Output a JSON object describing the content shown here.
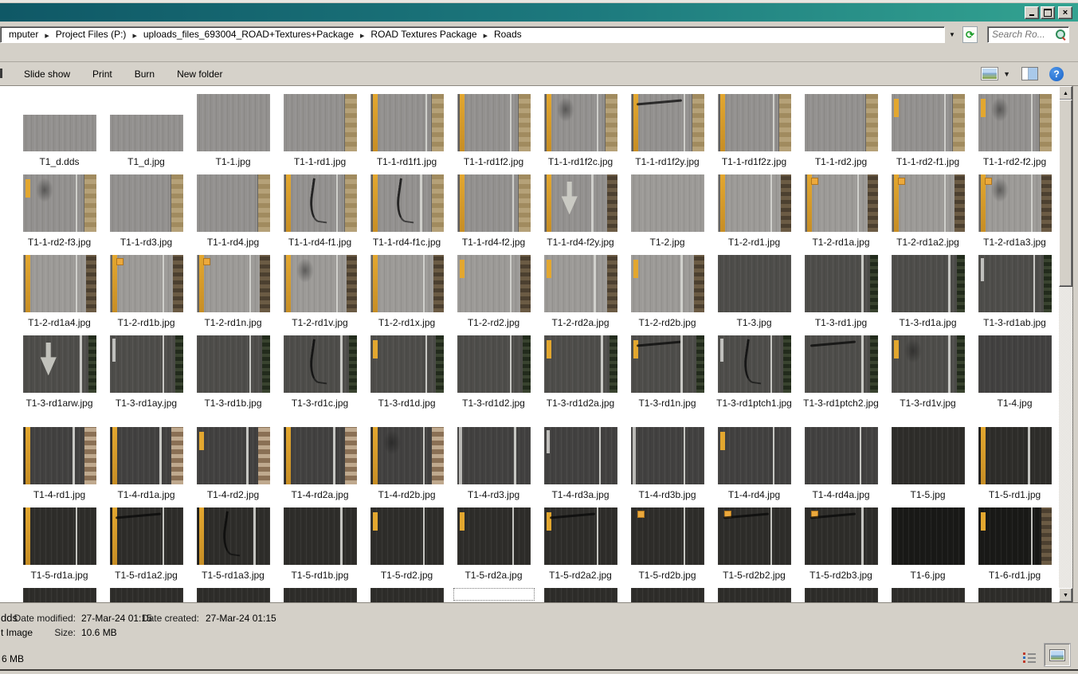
{
  "window": {
    "buttons": {
      "minimize": "minimize",
      "maximize": "maximize",
      "close": "close"
    },
    "titlebar_gradient": [
      "#0f5866",
      "#33a391"
    ]
  },
  "address_bar": {
    "breadcrumbs": [
      "mputer",
      "Project Files (P:)",
      "uploads_files_693004_ROAD+Textures+Package",
      "ROAD Textures Package",
      "Roads"
    ],
    "search_placeholder": "Search Ro..."
  },
  "toolbar": {
    "items": [
      "Slide show",
      "Print",
      "Burn",
      "New folder"
    ]
  },
  "files": [
    {
      "name": "T1_d.dds",
      "base": "g",
      "wide": true,
      "layers": []
    },
    {
      "name": "T1_d.jpg",
      "base": "g",
      "wide": true,
      "layers": []
    },
    {
      "name": "T1-1.jpg",
      "base": "g",
      "layers": []
    },
    {
      "name": "T1-1-rd1.jpg",
      "base": "g",
      "layers": [
        "dirt"
      ]
    },
    {
      "name": "T1-1-rd1f1.jpg",
      "base": "g",
      "layers": [
        "yl",
        "wl75",
        "dirt"
      ]
    },
    {
      "name": "T1-1-rd1f2.jpg",
      "base": "g",
      "layers": [
        "yl",
        "wl72",
        "dirt"
      ]
    },
    {
      "name": "T1-1-rd1f2c.jpg",
      "base": "g",
      "layers": [
        "yl",
        "smudge",
        "wl72",
        "dirt"
      ]
    },
    {
      "name": "T1-1-rd1f2y.jpg",
      "base": "g",
      "layers": [
        "yl",
        "crackh",
        "wl72",
        "dirt"
      ]
    },
    {
      "name": "T1-1-rd1f2z.jpg",
      "base": "g",
      "layers": [
        "yl",
        "wl75",
        "dirt"
      ]
    },
    {
      "name": "T1-1-rd2.jpg",
      "base": "g",
      "layers": [
        "dirt"
      ]
    },
    {
      "name": "T1-1-rd2-f1.jpg",
      "base": "g",
      "layers": [
        "ydash",
        "wl72",
        "dirt"
      ]
    },
    {
      "name": "T1-1-rd2-f2.jpg",
      "base": "g",
      "layers": [
        "ydash",
        "smudge",
        "wl72",
        "dirt"
      ]
    },
    {
      "name": "T1-1-rd2-f3.jpg",
      "base": "g",
      "layers": [
        "ydash",
        "smudge",
        "wl72",
        "dirt"
      ]
    },
    {
      "name": "T1-1-rd3.jpg",
      "base": "g",
      "layers": [
        "dirt"
      ]
    },
    {
      "name": "T1-1-rd4.jpg",
      "base": "g",
      "layers": [
        "dirt"
      ]
    },
    {
      "name": "T1-1-rd4-f1.jpg",
      "base": "g",
      "layers": [
        "yl",
        "crack",
        "wl72",
        "dirt"
      ]
    },
    {
      "name": "T1-1-rd4-f1c.jpg",
      "base": "g",
      "layers": [
        "yl",
        "crack",
        "wl68",
        "dirt"
      ]
    },
    {
      "name": "T1-1-rd4-f2.jpg",
      "base": "g",
      "layers": [
        "yl",
        "wl75",
        "dirt"
      ]
    },
    {
      "name": "T1-1-rd4-f2y.jpg",
      "base": "g",
      "layers": [
        "yl",
        "arrow",
        "wl65",
        "dirtdark"
      ]
    },
    {
      "name": "T1-2.jpg",
      "base": "g2",
      "layers": []
    },
    {
      "name": "T1-2-rd1.jpg",
      "base": "g2",
      "layers": [
        "yl",
        "wl72",
        "dirtdark"
      ]
    },
    {
      "name": "T1-2-rd1a.jpg",
      "base": "g2",
      "layers": [
        "yl",
        "ydot",
        "wl72",
        "dirtdark"
      ]
    },
    {
      "name": "T1-2-rd1a2.jpg",
      "base": "g2",
      "layers": [
        "yl",
        "ydot",
        "wl72",
        "dirtdark"
      ]
    },
    {
      "name": "T1-2-rd1a3.jpg",
      "base": "g2",
      "layers": [
        "yl",
        "ydot",
        "smudge",
        "wl72",
        "dirtdark"
      ]
    },
    {
      "name": "T1-2-rd1a4.jpg",
      "base": "g2",
      "layers": [
        "yl",
        "wl72",
        "dirtdark"
      ]
    },
    {
      "name": "T1-2-rd1b.jpg",
      "base": "g2",
      "layers": [
        "yl",
        "ydot",
        "wl72",
        "dirtdark"
      ]
    },
    {
      "name": "T1-2-rd1n.jpg",
      "base": "g2",
      "layers": [
        "yl",
        "ydot",
        "wl72",
        "dirtdark"
      ]
    },
    {
      "name": "T1-2-rd1v.jpg",
      "base": "g2",
      "layers": [
        "yl",
        "smudge",
        "wl72",
        "dirtdark"
      ]
    },
    {
      "name": "T1-2-rd1x.jpg",
      "base": "g2",
      "layers": [
        "yl",
        "wl72",
        "dirtdark"
      ]
    },
    {
      "name": "T1-2-rd2.jpg",
      "base": "g2",
      "layers": [
        "ydash",
        "wl72",
        "dirtdark"
      ]
    },
    {
      "name": "T1-2-rd2a.jpg",
      "base": "g2",
      "layers": [
        "ydash",
        "wl68",
        "dirtdark"
      ]
    },
    {
      "name": "T1-2-rd2b.jpg",
      "base": "g2",
      "layers": [
        "ydash",
        "wl68",
        "dirtdark"
      ]
    },
    {
      "name": "T1-3.jpg",
      "base": "d",
      "layers": []
    },
    {
      "name": "T1-3-rd1.jpg",
      "base": "d",
      "layers": [
        "wl78",
        "grass"
      ]
    },
    {
      "name": "T1-3-rd1a.jpg",
      "base": "d",
      "layers": [
        "wl78",
        "grass"
      ]
    },
    {
      "name": "T1-3-rd1ab.jpg",
      "base": "d",
      "layers": [
        "wdash",
        "wl75",
        "grass"
      ]
    },
    {
      "name": "T1-3-rd1arw.jpg",
      "base": "d",
      "layers": [
        "arrow",
        "wl78",
        "grass"
      ]
    },
    {
      "name": "T1-3-rd1ay.jpg",
      "base": "d",
      "layers": [
        "wdash",
        "wl72",
        "grass"
      ]
    },
    {
      "name": "T1-3-rd1b.jpg",
      "base": "d",
      "layers": [
        "wl72",
        "grass"
      ]
    },
    {
      "name": "T1-3-rd1c.jpg",
      "base": "d",
      "layers": [
        "crack",
        "wl78",
        "grass"
      ]
    },
    {
      "name": "T1-3-rd1d.jpg",
      "base": "d",
      "layers": [
        "ydash",
        "wl75",
        "grass"
      ]
    },
    {
      "name": "T1-3-rd1d2.jpg",
      "base": "d",
      "layers": [
        "wl72",
        "grass"
      ]
    },
    {
      "name": "T1-3-rd1d2a.jpg",
      "base": "d",
      "layers": [
        "ydash",
        "wl78",
        "grass"
      ]
    },
    {
      "name": "T1-3-rd1n.jpg",
      "base": "d",
      "layers": [
        "ydash",
        "crackh",
        "wl68",
        "grass"
      ]
    },
    {
      "name": "T1-3-rd1ptch1.jpg",
      "base": "d",
      "layers": [
        "wdash",
        "crack",
        "wl72",
        "grass"
      ]
    },
    {
      "name": "T1-3-rd1ptch2.jpg",
      "base": "d",
      "layers": [
        "crackh",
        "wl78",
        "grass"
      ]
    },
    {
      "name": "T1-3-rd1v.jpg",
      "base": "d",
      "layers": [
        "ydash",
        "smudge",
        "wl78",
        "grass"
      ]
    },
    {
      "name": "T1-4.jpg",
      "base": "d2",
      "layers": []
    },
    {
      "name": "T1-4-rd1.jpg",
      "base": "d2",
      "layers": [
        "yl",
        "wl68",
        "rust"
      ]
    },
    {
      "name": "T1-4-rd1a.jpg",
      "base": "d2",
      "layers": [
        "yl",
        "wl68",
        "rust"
      ]
    },
    {
      "name": "T1-4-rd2.jpg",
      "base": "d2",
      "layers": [
        "ydash",
        "wl68",
        "rust"
      ]
    },
    {
      "name": "T1-4-rd2a.jpg",
      "base": "d2",
      "layers": [
        "yl",
        "wl68",
        "rust"
      ]
    },
    {
      "name": "T1-4-rd2b.jpg",
      "base": "d2",
      "layers": [
        "yl",
        "smudge",
        "wl72",
        "rust"
      ]
    },
    {
      "name": "T1-4-rd3.jpg",
      "base": "d2",
      "layers": [
        "wlleft",
        "wl78"
      ]
    },
    {
      "name": "T1-4-rd3a.jpg",
      "base": "d2",
      "layers": [
        "wdash",
        "wl75"
      ]
    },
    {
      "name": "T1-4-rd3b.jpg",
      "base": "d2",
      "layers": [
        "wlleft",
        "wl72"
      ]
    },
    {
      "name": "T1-4-rd4.jpg",
      "base": "d2",
      "layers": [
        "ydash",
        "wl75"
      ]
    },
    {
      "name": "T1-4-rd4a.jpg",
      "base": "d2",
      "layers": [
        "wl75"
      ]
    },
    {
      "name": "T1-5.jpg",
      "base": "vd",
      "layers": []
    },
    {
      "name": "T1-5-rd1.jpg",
      "base": "vd",
      "layers": [
        "yl",
        "wl68"
      ]
    },
    {
      "name": "T1-5-rd1a.jpg",
      "base": "vd",
      "layers": [
        "yl",
        "wl72"
      ]
    },
    {
      "name": "T1-5-rd1a2.jpg",
      "base": "vd",
      "layers": [
        "yl",
        "crackh",
        "wl72"
      ]
    },
    {
      "name": "T1-5-rd1a3.jpg",
      "base": "vd",
      "layers": [
        "yl",
        "crack",
        "wl78"
      ]
    },
    {
      "name": "T1-5-rd1b.jpg",
      "base": "vd",
      "layers": [
        "wl78"
      ]
    },
    {
      "name": "T1-5-rd2.jpg",
      "base": "vd",
      "layers": [
        "ydash",
        "wl72"
      ]
    },
    {
      "name": "T1-5-rd2a.jpg",
      "base": "vd",
      "layers": [
        "ydash",
        "wl75"
      ]
    },
    {
      "name": "T1-5-rd2a2.jpg",
      "base": "vd",
      "layers": [
        "ydash",
        "crackh",
        "wl72"
      ]
    },
    {
      "name": "T1-5-rd2b.jpg",
      "base": "vd",
      "layers": [
        "ydot",
        "wl72"
      ]
    },
    {
      "name": "T1-5-rd2b2.jpg",
      "base": "vd",
      "layers": [
        "ydot",
        "crackh",
        "wl72"
      ]
    },
    {
      "name": "T1-5-rd2b3.jpg",
      "base": "vd",
      "layers": [
        "ydot",
        "crackh",
        "wl78"
      ]
    },
    {
      "name": "T1-6.jpg",
      "base": "bk",
      "layers": []
    },
    {
      "name": "T1-6-rd1.jpg",
      "base": "bk",
      "layers": [
        "ydash",
        "wl72",
        "dirtdark"
      ]
    }
  ],
  "partial_row": [
    "vd",
    "vd",
    "vd",
    "vd",
    "vd",
    "focus",
    "vd",
    "vd",
    "vd",
    "vd",
    "vd",
    "vd"
  ],
  "details_pane": {
    "filename_fragment": "dds",
    "type_fragment": "t Image",
    "date_modified_label": "Date modified:",
    "date_modified": "27-Mar-24 01:15",
    "date_created_label": "Date created:",
    "date_created": "27-Mar-24 01:15",
    "size_label": "Size:",
    "size": "10.6 MB"
  },
  "status_bar": {
    "size_fragment": "6 MB"
  },
  "icons": [
    "breadcrumb-arrow-icon",
    "address-dropdown-icon",
    "refresh-icon",
    "search-icon",
    "views-icon",
    "views-caret-icon",
    "preview-pane-icon",
    "help-icon",
    "list-view-icon",
    "thumbnail-view-icon"
  ]
}
